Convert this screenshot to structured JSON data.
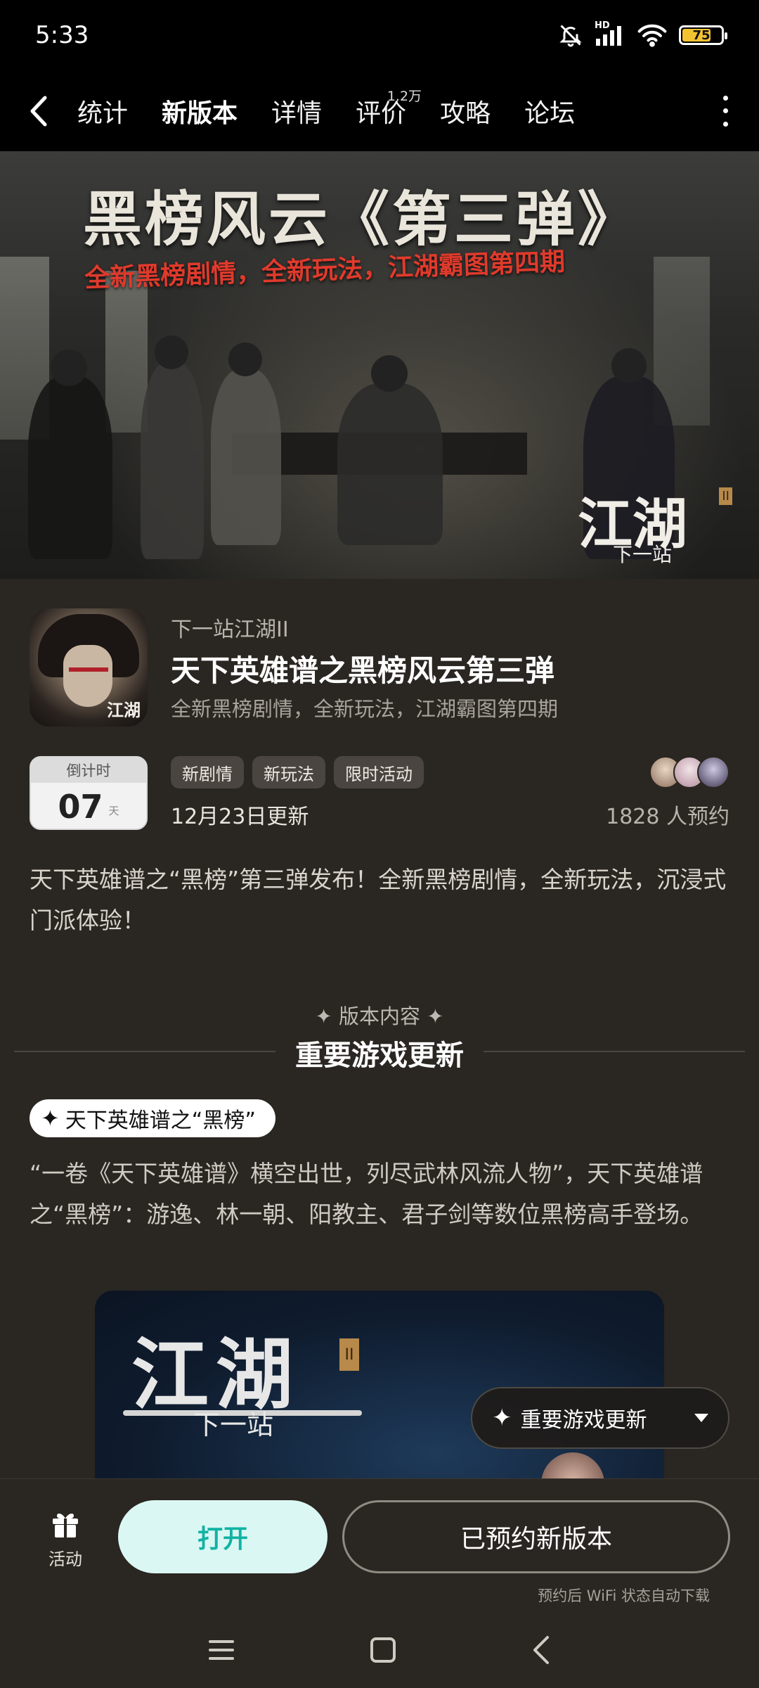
{
  "status_bar": {
    "time": "5:33",
    "network_label": "HD",
    "battery": "75",
    "battery_level": 0.75,
    "battery_color": "#f2c230",
    "icons": [
      "bell-off-icon",
      "signal-icon",
      "wifi-icon",
      "battery-icon"
    ]
  },
  "nav": {
    "tabs": [
      {
        "label": "统计"
      },
      {
        "label": "新版本",
        "active": true
      },
      {
        "label": "详情"
      },
      {
        "label": "评价",
        "badge": "1.2万"
      },
      {
        "label": "攻略"
      },
      {
        "label": "论坛"
      }
    ],
    "accent": "#1fcfc0"
  },
  "banner": {
    "title": "黑榜风云《第三弹》",
    "subtitle": "全新黑榜剧情，全新玩法，江湖霸图第四期",
    "logo_main": "江湖",
    "logo_badge": "II",
    "logo_sub": "下一站"
  },
  "game": {
    "name": "下一站江湖II",
    "icon_text": "江湖",
    "version_title": "天下英雄谱之黑榜风云第三弹",
    "version_desc": "全新黑榜剧情，全新玩法，江湖霸图第四期"
  },
  "countdown": {
    "label": "倒计时",
    "value": "07",
    "unit": "天"
  },
  "tags": [
    "新剧情",
    "新玩法",
    "限时活动"
  ],
  "update_date": "12月23日更新",
  "reserve_count": "1828 人预约",
  "intro": "天下英雄谱之“黑榜”第三弹发布！全新黑榜剧情，全新玩法，沉浸式门派体验！",
  "section": {
    "kicker": "版本内容",
    "title": "重要游戏更新"
  },
  "feature": {
    "tag": "天下英雄谱之“黑榜”",
    "body": "“一卷《天下英雄谱》横空出世，列尽武林风流人物”，天下英雄谱之“黑榜”：游逸、林一朝、阳教主、君子剑等数位黑榜高手登场。",
    "image_logo": "江湖",
    "image_logo_sub": "下一站",
    "image_badge": "II"
  },
  "floating_nav": {
    "label": "重要游戏更新"
  },
  "bottom": {
    "activity_label": "活动",
    "open_label": "打开",
    "reserved_label": "已预约新版本",
    "wifi_note": "预约后 WiFi 状态自动下载"
  }
}
